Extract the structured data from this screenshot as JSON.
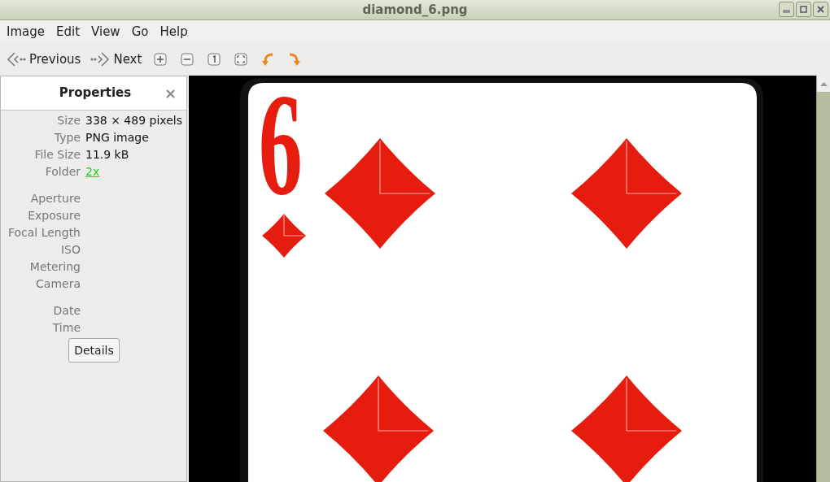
{
  "window": {
    "title": "diamond_6.png"
  },
  "menu": [
    "Image",
    "Edit",
    "View",
    "Go",
    "Help"
  ],
  "toolbar": {
    "previous": "Previous",
    "next": "Next"
  },
  "properties": {
    "title": "Properties",
    "close": "×",
    "groups": [
      [
        {
          "label": "Size",
          "value": "338 × 489 pixels",
          "kind": "text"
        },
        {
          "label": "Type",
          "value": "PNG image",
          "kind": "text"
        },
        {
          "label": "File Size",
          "value": "11.9 kB",
          "kind": "text"
        },
        {
          "label": "Folder",
          "value": "2x",
          "kind": "link"
        }
      ],
      [
        {
          "label": "Aperture"
        },
        {
          "label": "Exposure"
        },
        {
          "label": "Focal Length"
        },
        {
          "label": "ISO"
        },
        {
          "label": "Metering"
        },
        {
          "label": "Camera"
        }
      ],
      [
        {
          "label": "Date"
        },
        {
          "label": "Time"
        }
      ]
    ],
    "button": "Details"
  },
  "image": {
    "card_rank": "6"
  }
}
